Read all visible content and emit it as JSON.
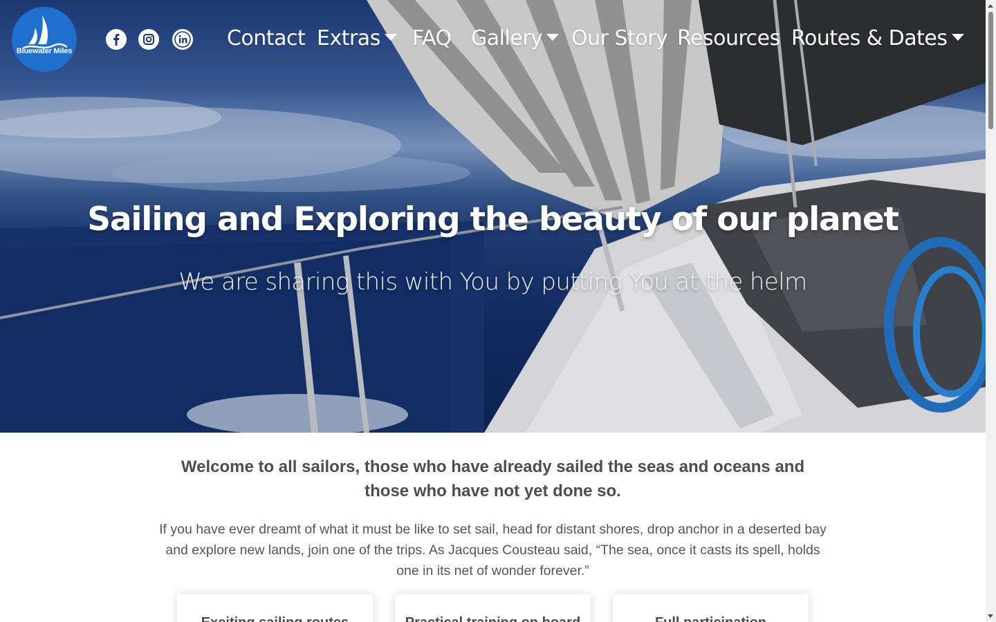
{
  "brand": {
    "name": "Bluewater Miles"
  },
  "social": [
    {
      "name": "facebook",
      "icon": "facebook-icon"
    },
    {
      "name": "instagram",
      "icon": "instagram-icon"
    },
    {
      "name": "linkedin",
      "icon": "linkedin-icon"
    }
  ],
  "nav": {
    "items": [
      {
        "label": "Contact",
        "has_dropdown": false
      },
      {
        "label": "Extras",
        "has_dropdown": true
      },
      {
        "label": "FAQ",
        "has_dropdown": false
      },
      {
        "label": "Gallery",
        "has_dropdown": true
      },
      {
        "label": "Our Story",
        "has_dropdown": false
      },
      {
        "label": "Resources",
        "has_dropdown": false
      },
      {
        "label": "Routes & Dates",
        "has_dropdown": true
      }
    ]
  },
  "hero": {
    "title": "Sailing and Exploring the beauty of our planet",
    "subtitle": "We are sharing this with You by putting You at the helm"
  },
  "intro": {
    "heading": "Welcome to all sailors, those who have already sailed the seas and oceans and those who have not yet done so.",
    "text": "If you have ever dreamt of what it must be like to set sail, head for distant shores, drop anchor in a deserted bay and explore new lands, join one of the trips. As Jacques Cousteau said, “The sea, once it casts its spell, holds one in its net of wonder forever.”"
  },
  "cards": [
    {
      "title": "Exciting sailing routes"
    },
    {
      "title": "Practical training on board"
    },
    {
      "title": "Full participation"
    }
  ],
  "colors": {
    "logo_bg": "#1f6fcf",
    "text_dark": "#4d4d4d",
    "nav_text": "#ffffff"
  }
}
